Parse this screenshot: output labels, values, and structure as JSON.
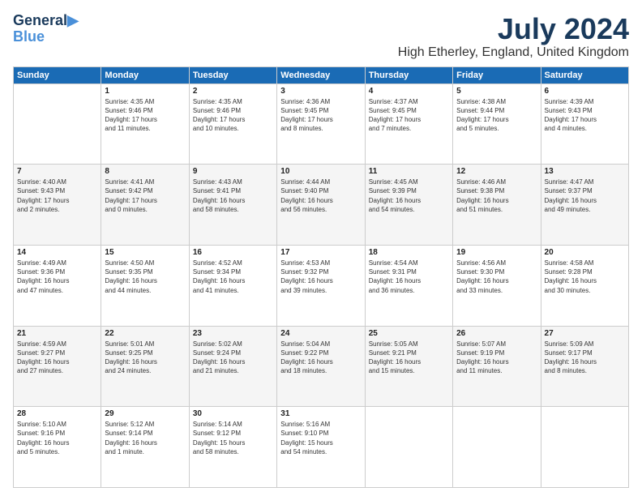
{
  "logo": {
    "line1": "General",
    "line2": "Blue"
  },
  "title": "July 2024",
  "location": "High Etherley, England, United Kingdom",
  "days_header": [
    "Sunday",
    "Monday",
    "Tuesday",
    "Wednesday",
    "Thursday",
    "Friday",
    "Saturday"
  ],
  "weeks": [
    [
      {
        "day": "",
        "content": ""
      },
      {
        "day": "1",
        "content": "Sunrise: 4:35 AM\nSunset: 9:46 PM\nDaylight: 17 hours\nand 11 minutes."
      },
      {
        "day": "2",
        "content": "Sunrise: 4:35 AM\nSunset: 9:46 PM\nDaylight: 17 hours\nand 10 minutes."
      },
      {
        "day": "3",
        "content": "Sunrise: 4:36 AM\nSunset: 9:45 PM\nDaylight: 17 hours\nand 8 minutes."
      },
      {
        "day": "4",
        "content": "Sunrise: 4:37 AM\nSunset: 9:45 PM\nDaylight: 17 hours\nand 7 minutes."
      },
      {
        "day": "5",
        "content": "Sunrise: 4:38 AM\nSunset: 9:44 PM\nDaylight: 17 hours\nand 5 minutes."
      },
      {
        "day": "6",
        "content": "Sunrise: 4:39 AM\nSunset: 9:43 PM\nDaylight: 17 hours\nand 4 minutes."
      }
    ],
    [
      {
        "day": "7",
        "content": "Sunrise: 4:40 AM\nSunset: 9:43 PM\nDaylight: 17 hours\nand 2 minutes."
      },
      {
        "day": "8",
        "content": "Sunrise: 4:41 AM\nSunset: 9:42 PM\nDaylight: 17 hours\nand 0 minutes."
      },
      {
        "day": "9",
        "content": "Sunrise: 4:43 AM\nSunset: 9:41 PM\nDaylight: 16 hours\nand 58 minutes."
      },
      {
        "day": "10",
        "content": "Sunrise: 4:44 AM\nSunset: 9:40 PM\nDaylight: 16 hours\nand 56 minutes."
      },
      {
        "day": "11",
        "content": "Sunrise: 4:45 AM\nSunset: 9:39 PM\nDaylight: 16 hours\nand 54 minutes."
      },
      {
        "day": "12",
        "content": "Sunrise: 4:46 AM\nSunset: 9:38 PM\nDaylight: 16 hours\nand 51 minutes."
      },
      {
        "day": "13",
        "content": "Sunrise: 4:47 AM\nSunset: 9:37 PM\nDaylight: 16 hours\nand 49 minutes."
      }
    ],
    [
      {
        "day": "14",
        "content": "Sunrise: 4:49 AM\nSunset: 9:36 PM\nDaylight: 16 hours\nand 47 minutes."
      },
      {
        "day": "15",
        "content": "Sunrise: 4:50 AM\nSunset: 9:35 PM\nDaylight: 16 hours\nand 44 minutes."
      },
      {
        "day": "16",
        "content": "Sunrise: 4:52 AM\nSunset: 9:34 PM\nDaylight: 16 hours\nand 41 minutes."
      },
      {
        "day": "17",
        "content": "Sunrise: 4:53 AM\nSunset: 9:32 PM\nDaylight: 16 hours\nand 39 minutes."
      },
      {
        "day": "18",
        "content": "Sunrise: 4:54 AM\nSunset: 9:31 PM\nDaylight: 16 hours\nand 36 minutes."
      },
      {
        "day": "19",
        "content": "Sunrise: 4:56 AM\nSunset: 9:30 PM\nDaylight: 16 hours\nand 33 minutes."
      },
      {
        "day": "20",
        "content": "Sunrise: 4:58 AM\nSunset: 9:28 PM\nDaylight: 16 hours\nand 30 minutes."
      }
    ],
    [
      {
        "day": "21",
        "content": "Sunrise: 4:59 AM\nSunset: 9:27 PM\nDaylight: 16 hours\nand 27 minutes."
      },
      {
        "day": "22",
        "content": "Sunrise: 5:01 AM\nSunset: 9:25 PM\nDaylight: 16 hours\nand 24 minutes."
      },
      {
        "day": "23",
        "content": "Sunrise: 5:02 AM\nSunset: 9:24 PM\nDaylight: 16 hours\nand 21 minutes."
      },
      {
        "day": "24",
        "content": "Sunrise: 5:04 AM\nSunset: 9:22 PM\nDaylight: 16 hours\nand 18 minutes."
      },
      {
        "day": "25",
        "content": "Sunrise: 5:05 AM\nSunset: 9:21 PM\nDaylight: 16 hours\nand 15 minutes."
      },
      {
        "day": "26",
        "content": "Sunrise: 5:07 AM\nSunset: 9:19 PM\nDaylight: 16 hours\nand 11 minutes."
      },
      {
        "day": "27",
        "content": "Sunrise: 5:09 AM\nSunset: 9:17 PM\nDaylight: 16 hours\nand 8 minutes."
      }
    ],
    [
      {
        "day": "28",
        "content": "Sunrise: 5:10 AM\nSunset: 9:16 PM\nDaylight: 16 hours\nand 5 minutes."
      },
      {
        "day": "29",
        "content": "Sunrise: 5:12 AM\nSunset: 9:14 PM\nDaylight: 16 hours\nand 1 minute."
      },
      {
        "day": "30",
        "content": "Sunrise: 5:14 AM\nSunset: 9:12 PM\nDaylight: 15 hours\nand 58 minutes."
      },
      {
        "day": "31",
        "content": "Sunrise: 5:16 AM\nSunset: 9:10 PM\nDaylight: 15 hours\nand 54 minutes."
      },
      {
        "day": "",
        "content": ""
      },
      {
        "day": "",
        "content": ""
      },
      {
        "day": "",
        "content": ""
      }
    ]
  ]
}
